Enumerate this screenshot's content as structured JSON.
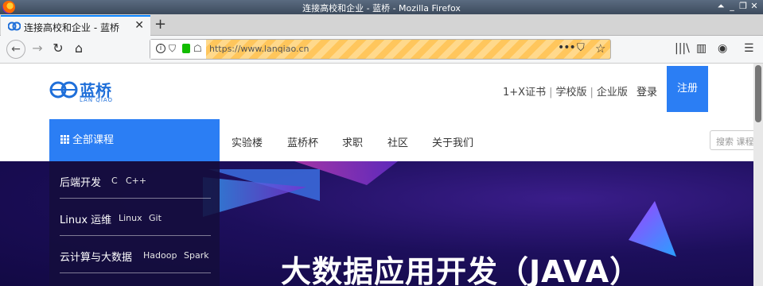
{
  "window": {
    "title": "连接高校和企业 - 蓝桥 - Mozilla Firefox",
    "controls": [
      "⏶",
      "_",
      "❐",
      "✕"
    ]
  },
  "tab": {
    "title": "连接高校和企业 - 蓝桥",
    "close": "✕",
    "new_tab": "+"
  },
  "toolbar": {
    "back": "←",
    "forward": "→",
    "reload": "↻",
    "home": "⌂",
    "url": "https://www.lanqiao.cn",
    "more": "•••",
    "library": "|||\\",
    "sidebar": "▥",
    "account": "◉",
    "menu": "☰"
  },
  "site": {
    "logo_text": "蓝桥",
    "logo_sub": "LAN QIAO",
    "top_links": [
      "1+X证书",
      "学校版",
      "企业版"
    ],
    "login": "登录",
    "register": "注册",
    "all_courses": "全部课程",
    "nav": [
      "实验楼",
      "蓝桥杯",
      "求职",
      "社区",
      "关于我们"
    ],
    "search_placeholder": "搜索 课程",
    "categories": [
      {
        "name": "后端开发",
        "tags": [
          "C",
          "C++"
        ]
      },
      {
        "name": "Linux 运维",
        "tags": [
          "Linux",
          "Git"
        ]
      },
      {
        "name": "云计算与大数据",
        "tags": [
          "Hadoop",
          "Spark"
        ]
      }
    ],
    "banner_title": "大数据应用开发（JAVA）"
  },
  "colors": {
    "brand_blue": "#2b7ef4",
    "banner_bg": "#1d0f5c"
  }
}
